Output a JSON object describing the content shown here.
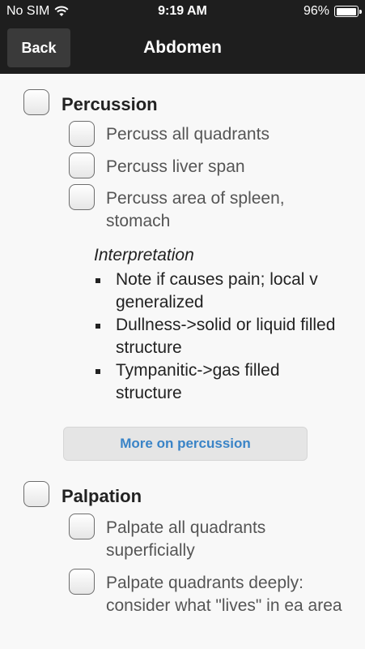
{
  "status_bar": {
    "carrier": "No SIM",
    "time": "9:19 AM",
    "battery": "96%"
  },
  "nav": {
    "back_label": "Back",
    "title": "Abdomen"
  },
  "sections": {
    "percussion": {
      "title": "Percussion",
      "items": [
        "Percuss all quadrants",
        "Percuss liver span",
        "Percuss area of spleen, stomach"
      ],
      "interpretation_title": "Interpretation",
      "interpretation_items": [
        "Note if causes pain; local v generalized",
        "Dullness->solid or liquid filled structure",
        "Tympanitic->gas filled structure"
      ],
      "more_button": "More on percussion"
    },
    "palpation": {
      "title": "Palpation",
      "items": [
        "Palpate all quadrants superficially",
        "Palpate quadrants deeply: consider what \"lives\" in ea area"
      ]
    }
  },
  "colors": {
    "bar": "#1e1e1e",
    "link": "#3a84c7",
    "background": "#f8f8f8"
  }
}
